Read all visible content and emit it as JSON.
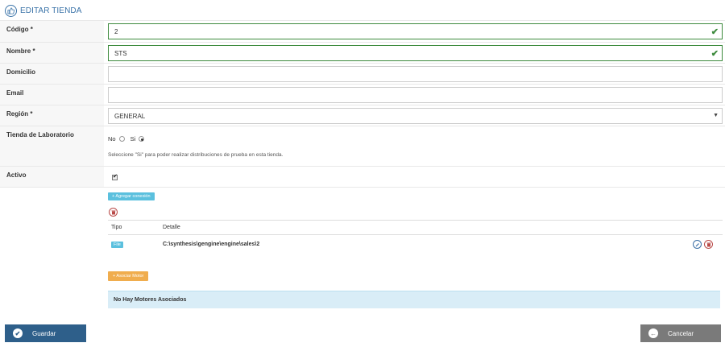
{
  "header": {
    "title": "EDITAR TIENDA",
    "icon": "thumbs-up-icon"
  },
  "fields": {
    "codigo": {
      "label": "Código *",
      "value": "2"
    },
    "nombre": {
      "label": "Nombre *",
      "value": "STS"
    },
    "domicilio": {
      "label": "Domicilio",
      "value": ""
    },
    "email": {
      "label": "Email",
      "value": ""
    },
    "region": {
      "label": "Región *",
      "value": "GENERAL"
    },
    "laboratorio": {
      "label": "Tienda de Laboratorio",
      "option_no": "No",
      "option_si": "Si",
      "selected": "Si",
      "hint": "Seleccione \"Si\" para poder realizar distribuciones de prueba en esta tienda."
    },
    "activo": {
      "label": "Activo",
      "checked": true
    }
  },
  "connections": {
    "add_label": "+ Agregar conexión",
    "headers": {
      "tipo": "Tipo",
      "detalle": "Detalle"
    },
    "rows": [
      {
        "tipo": "File",
        "detalle": "C:\\synthesis\\gengine\\engine\\sales\\2"
      }
    ]
  },
  "motors": {
    "add_label": "+ Asociar Motor",
    "empty_text": "No Hay Motores Asociados"
  },
  "footer": {
    "save_label": "Guardar",
    "cancel_label": "Cancelar"
  },
  "colors": {
    "primary": "#2e5f8a",
    "valid": "#3c8a3c",
    "info": "#5bc0de",
    "warning": "#f0ad4e",
    "danger": "#b94a48"
  }
}
